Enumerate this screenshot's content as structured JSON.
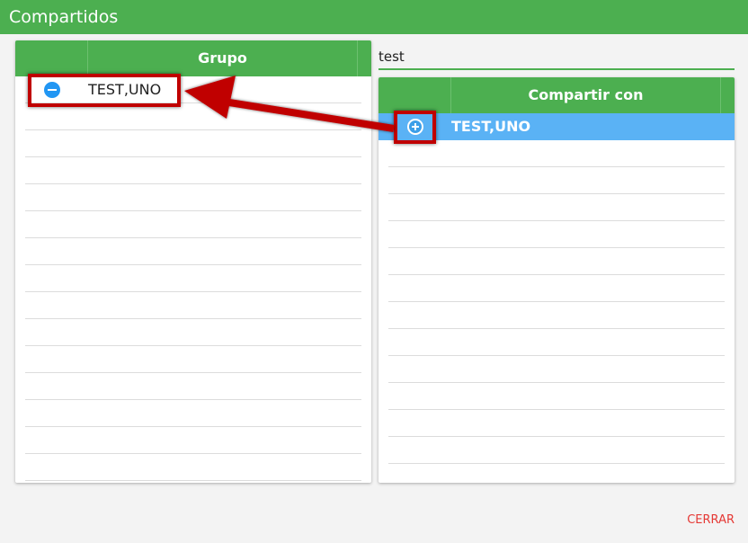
{
  "window": {
    "title": "Compartidos"
  },
  "left_grid": {
    "header": "Grupo",
    "rows": [
      {
        "label": "TEST,UNO",
        "action_icon": "minus-circle-icon"
      }
    ]
  },
  "search": {
    "value": "test"
  },
  "right_grid": {
    "header": "Compartir con",
    "rows": [
      {
        "label": "TEST,UNO",
        "action_icon": "plus-circle-icon",
        "selected": true
      }
    ]
  },
  "footer": {
    "close_label": "CERRAR"
  },
  "colors": {
    "accent_green": "#4caf50",
    "selected_row_blue": "#5ab2f5",
    "callout_red": "#c00000",
    "close_red": "#e53935"
  }
}
